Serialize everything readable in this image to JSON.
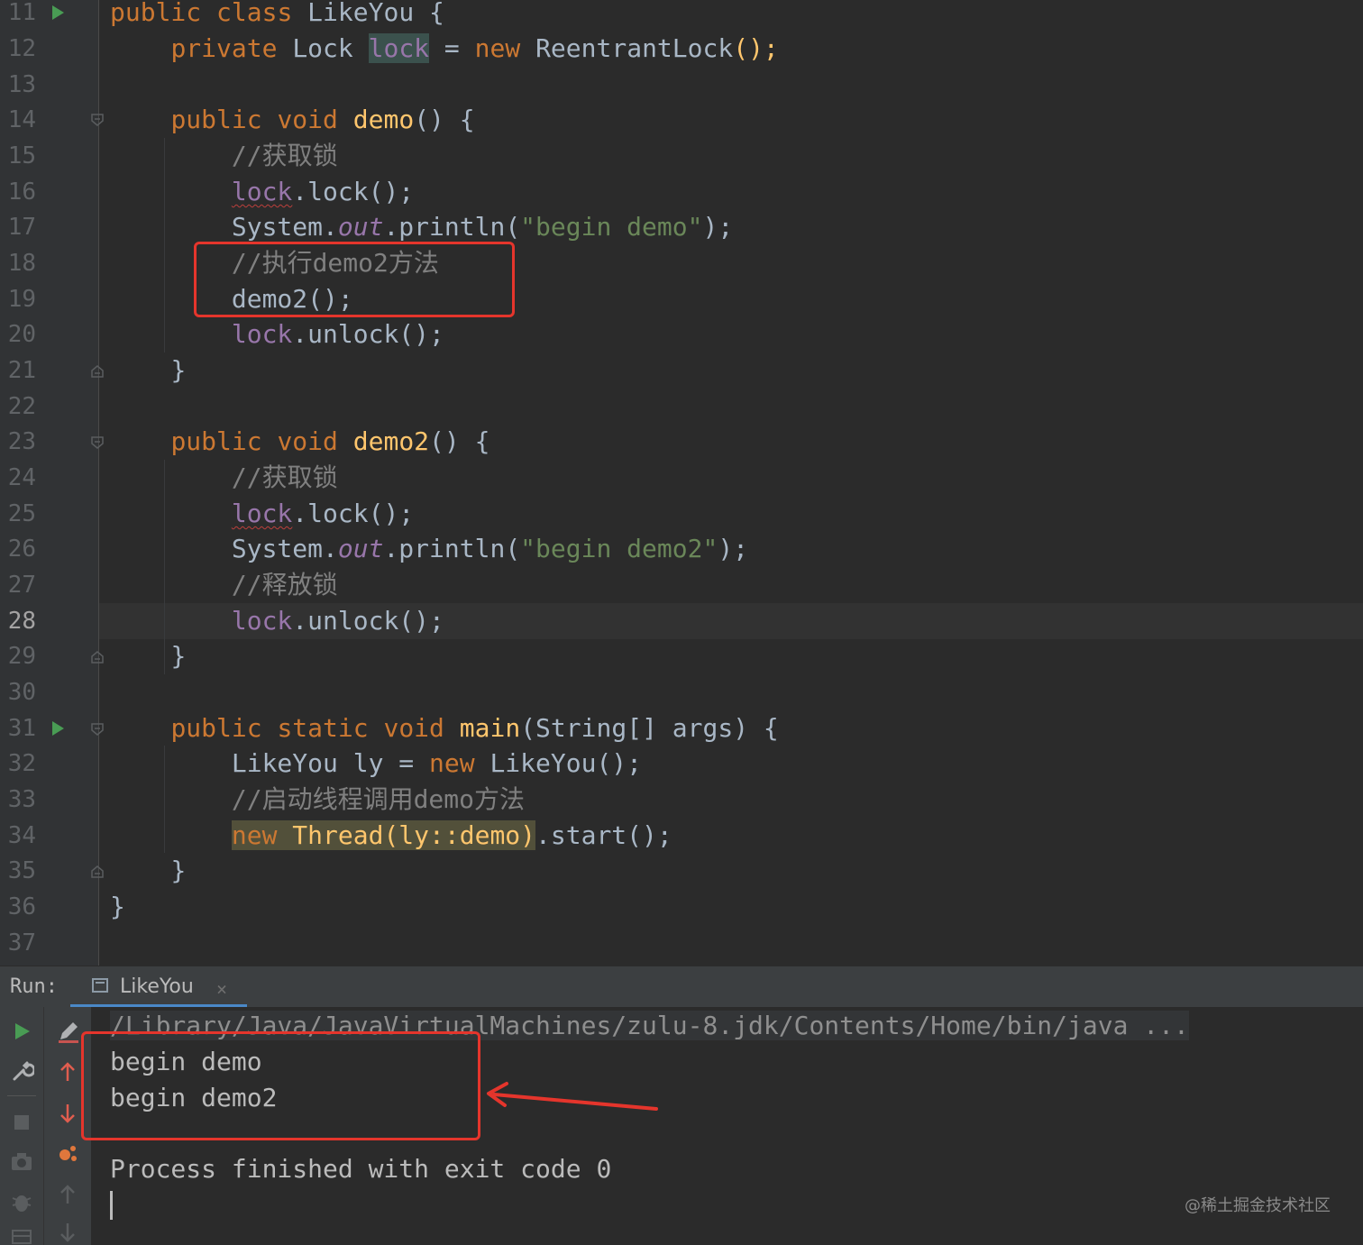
{
  "editor": {
    "current_line": "28",
    "lines": [
      {
        "no": "11"
      },
      {
        "no": "12"
      },
      {
        "no": "13"
      },
      {
        "no": "14"
      },
      {
        "no": "15"
      },
      {
        "no": "16"
      },
      {
        "no": "17"
      },
      {
        "no": "18"
      },
      {
        "no": "19"
      },
      {
        "no": "20"
      },
      {
        "no": "21"
      },
      {
        "no": "22"
      },
      {
        "no": "23"
      },
      {
        "no": "24"
      },
      {
        "no": "25"
      },
      {
        "no": "26"
      },
      {
        "no": "27"
      },
      {
        "no": "28"
      },
      {
        "no": "29"
      },
      {
        "no": "30"
      },
      {
        "no": "31"
      },
      {
        "no": "32"
      },
      {
        "no": "33"
      },
      {
        "no": "34"
      },
      {
        "no": "35"
      },
      {
        "no": "36"
      },
      {
        "no": "37"
      }
    ],
    "code": {
      "l11": {
        "public": "public",
        "class": "class",
        "name": "LikeYou",
        "brace": "{"
      },
      "l12": {
        "private": "private",
        "type": "Lock",
        "field": "lock",
        "eq": "=",
        "new": "new",
        "ctor": "ReentrantLock",
        "end": "();"
      },
      "l14": {
        "public": "public",
        "void": "void",
        "name": "demo",
        "rest": "() {"
      },
      "l15": {
        "comment": "//获取锁"
      },
      "l16": {
        "field": "lock",
        "rest": ".lock();"
      },
      "l17": {
        "pre": "System.",
        "out": "out",
        "mid": ".println(",
        "str": "\"begin demo\"",
        "end": ");"
      },
      "l18": {
        "comment": "//执行demo2方法"
      },
      "l19": {
        "text": "demo2();"
      },
      "l20": {
        "field": "lock",
        "rest": ".unlock();"
      },
      "l21": {
        "text": "}"
      },
      "l23": {
        "public": "public",
        "void": "void",
        "name": "demo2",
        "rest": "() {"
      },
      "l24": {
        "comment": "//获取锁"
      },
      "l25": {
        "field": "lock",
        "rest": ".lock();"
      },
      "l26": {
        "pre": "System.",
        "out": "out",
        "mid": ".println(",
        "str": "\"begin demo2\"",
        "end": ");"
      },
      "l27": {
        "comment": "//释放锁"
      },
      "l28": {
        "field": "lock",
        "rest": ".unlock();"
      },
      "l29": {
        "text": "}"
      },
      "l31": {
        "public": "public",
        "static": "static",
        "void": "void",
        "name": "main",
        "rest": "(String[] args) {"
      },
      "l32": {
        "pre": "LikeYou ly = ",
        "new": "new",
        "rest": " LikeYou();"
      },
      "l33": {
        "comment": "//启动线程调用demo方法"
      },
      "l34": {
        "new": "new",
        "hl": " Thread(ly::demo)",
        "rest": ".start();"
      },
      "l35": {
        "text": "}"
      },
      "l36": {
        "text": "}"
      }
    }
  },
  "run_panel": {
    "label": "Run:",
    "tab_label": "LikeYou",
    "tab_close": "×",
    "console": {
      "command": "/Library/Java/JavaVirtualMachines/zulu-8.jdk/Contents/Home/bin/java ...",
      "output": [
        "begin demo",
        "begin demo2"
      ],
      "exit": "Process finished with exit code 0"
    },
    "toolbar_icons": [
      "rerun-icon",
      "wrench-icon",
      "stop-icon",
      "camera-icon",
      "debug-icon",
      "layout-icon",
      "edit-icon",
      "up-arrow-icon",
      "down-arrow-icon",
      "pin-icon",
      "up-icon",
      "down-icon"
    ]
  },
  "colors": {
    "keyword": "#cc7832",
    "method": "#ffc66d",
    "string": "#6a8759",
    "comment": "#808080",
    "field": "#9876aa",
    "annotation_red": "#e5352c"
  },
  "watermark": "@稀土掘金技术社区"
}
